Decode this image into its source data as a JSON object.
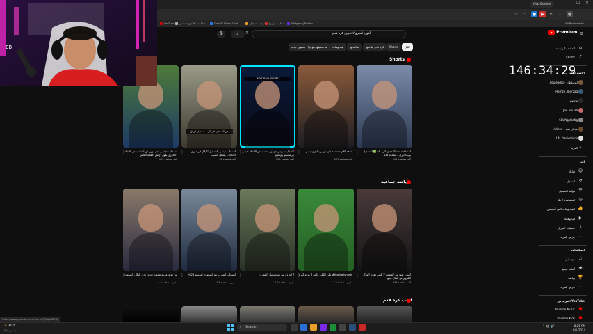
{
  "browser": {
    "gemini_label": "Ask Gemini",
    "all_bookmarks": "All Bookmarks",
    "bookmarks": [
      {
        "label": "YouTube"
      },
      {
        "label": "مشاهدة أفلام ومسلسل"
      },
      {
        "label": "OneTV Video Chat..."
      },
      {
        "label": "ديفيد - تسجيل"
      },
      {
        "label": "حسابات (ويبو)"
      },
      {
        "label": "Widgets | Butter..."
      }
    ],
    "status_url": "https://www.youtube.com/shorts/7tj0q9nBOfQ"
  },
  "header": {
    "logo_label": "Premium",
    "search_query": "أقوى استرو لا تعرف كرة قدم"
  },
  "chips": [
    "الكل",
    "Shorts",
    "كرة قدم ملاعبها",
    "شاهدتها",
    "فيديوهات",
    "تم تحميلها مؤخرًا",
    "محتوى جديد"
  ],
  "timer": "146:34:29",
  "guide": {
    "top": [
      {
        "label": "الصفحة الرئيسية",
        "icon": "home-icon"
      },
      {
        "label": "Shorts",
        "icon": "shorts-icon"
      }
    ],
    "subs_title": "الاشتراكات",
    "subs": [
      {
        "label": "Abuleadiq - أبوسلطان"
      },
      {
        "label": "Hamze Abdrzaq"
      },
      {
        "label": "مالكوم"
      },
      {
        "label": "Joe HaiTab"
      },
      {
        "label": "SHoNgoBoNg"
      },
      {
        "label": "Adnan - عدنان سيد"
      },
      {
        "label": "HM Productions"
      },
      {
        "label": "المزيد"
      }
    ],
    "you_title": "أنت",
    "you": [
      {
        "label": "قناتك",
        "icon": "channel-icon"
      },
      {
        "label": "السجل",
        "icon": "history-icon"
      },
      {
        "label": "قوائم التشغيل",
        "icon": "playlist-icon"
      },
      {
        "label": "المشاهدة لاحقًا",
        "icon": "clock-icon"
      },
      {
        "label": "الفيديوهات التي أعجبتني",
        "icon": "like-icon"
      },
      {
        "label": "فيديوهاتك",
        "icon": "video-icon"
      },
      {
        "label": "عمليات التنزيل",
        "icon": "download-icon"
      },
      {
        "label": "عرض المزيد",
        "icon": "chevron-down-icon"
      }
    ],
    "explore_title": "استكشاف",
    "explore": [
      {
        "label": "موسيقى",
        "icon": "music-icon"
      },
      {
        "label": "ألعاب فيديو",
        "icon": "gaming-icon"
      },
      {
        "label": "رياضة",
        "icon": "sports-icon"
      },
      {
        "label": "عرض المزيد",
        "icon": "chevron-down-icon"
      }
    ],
    "more_title": "المزيد من YouTube",
    "more": [
      {
        "label": "YouTube Music"
      },
      {
        "label": "YouTube Kids"
      }
    ]
  },
  "sections": {
    "shorts": "Shorts",
    "team_sports": "رياضة جماعية",
    "football_player": "لاعب كرة قدم"
  },
  "shorts_row": [
    {
      "title": "لمشاهدة بقية المقطع، الرسالة ✅ للتسجيل يريده لتري... تشاهد كلام",
      "views": "102 ألف مشاهدة",
      "thumb": [
        "#7a8ba8",
        "#2f3b55"
      ],
      "overlay": ""
    },
    {
      "title": "شاهد كلام محمد عبدان عن رونالدو وميسي",
      "views": "223 ألف مشاهدة",
      "thumb": [
        "#8a5a3a",
        "#1d1d22"
      ],
      "overlay": ""
    },
    {
      "title": "فاينيسيوس جونيور يتحدث عن الاتحاد عيسى VS كريستيانو رونالدو",
      "views": "626 ألف مشاهدة",
      "thumb": [
        "#0b1a3a",
        "#0a0a14"
      ],
      "overlay": "FOOTBALL SPORT"
    },
    {
      "title": "انسحاب ميسي للتسجيل للهلال في دوري الاتحاد... يشكل السبب",
      "views": "42 ألف مشاهدة",
      "thumb": [
        "#9a9a88",
        "#3d3a30"
      ],
      "overlay": "هي أنا داخل على آي ... تسجيل للهلال"
    },
    {
      "title": "انسحاب نجاسي نجم بوزر عن الشعب عن الاتحاد الخرزي يقول \"إيش الأهلية الكأس\"",
      "views": "100 ألف مشاهدة",
      "thumb": [
        "#4d7a3a",
        "#1e3b66"
      ],
      "overlay": ""
    }
  ],
  "team_row": [
    {
      "title": "استرو يعود من المطعم لا يلعب دوري الهلال الكروي مع المال جيلو",
      "views": "845 ألف مشاهدة",
      "thumb": [
        "#4a3a3a",
        "#151515"
      ]
    },
    {
      "title": "على الليلي خاص لا يوجد لكرة #footballshorts",
      "views": "2.2 مليون مشاهدة",
      "thumb": [
        "#3a8a3a",
        "#245f24"
      ]
    },
    {
      "title": "لا أعرف من هو تسجيل الشعري",
      "views": "2.2 مليون مشاهدة",
      "thumb": [
        "#6a7a5a",
        "#2a3228"
      ]
    },
    {
      "title": "انسحاب المدرب مع السعودي لموسم 2024",
      "views": "1.9 مليون مشاهدة",
      "thumb": [
        "#7a8a9a",
        "#1f2a40"
      ]
    },
    {
      "title": "من دولة عربية تتحدث دوري نادي الهلال السعودي",
      "views": "4.3 مليون مشاهدة",
      "thumb": [
        "#8a7a6a",
        "#2a2a40"
      ]
    }
  ],
  "bottom_thumbs": [
    {
      "thumb": [
        "#555",
        "#222"
      ]
    },
    {
      "thumb": [
        "#6a5a4a",
        "#2a2a2a"
      ]
    },
    {
      "thumb": [
        "#7a7a70",
        "#333"
      ]
    },
    {
      "thumb": [
        "#888",
        "#333"
      ]
    },
    {
      "thumb": [
        "#111",
        "#000"
      ]
    }
  ],
  "taskbar": {
    "search_placeholder": "Search",
    "time": "8:25 PM",
    "date": "8/1/2024",
    "weather": "31°C",
    "weather_desc": "مشمس غالبًا"
  }
}
